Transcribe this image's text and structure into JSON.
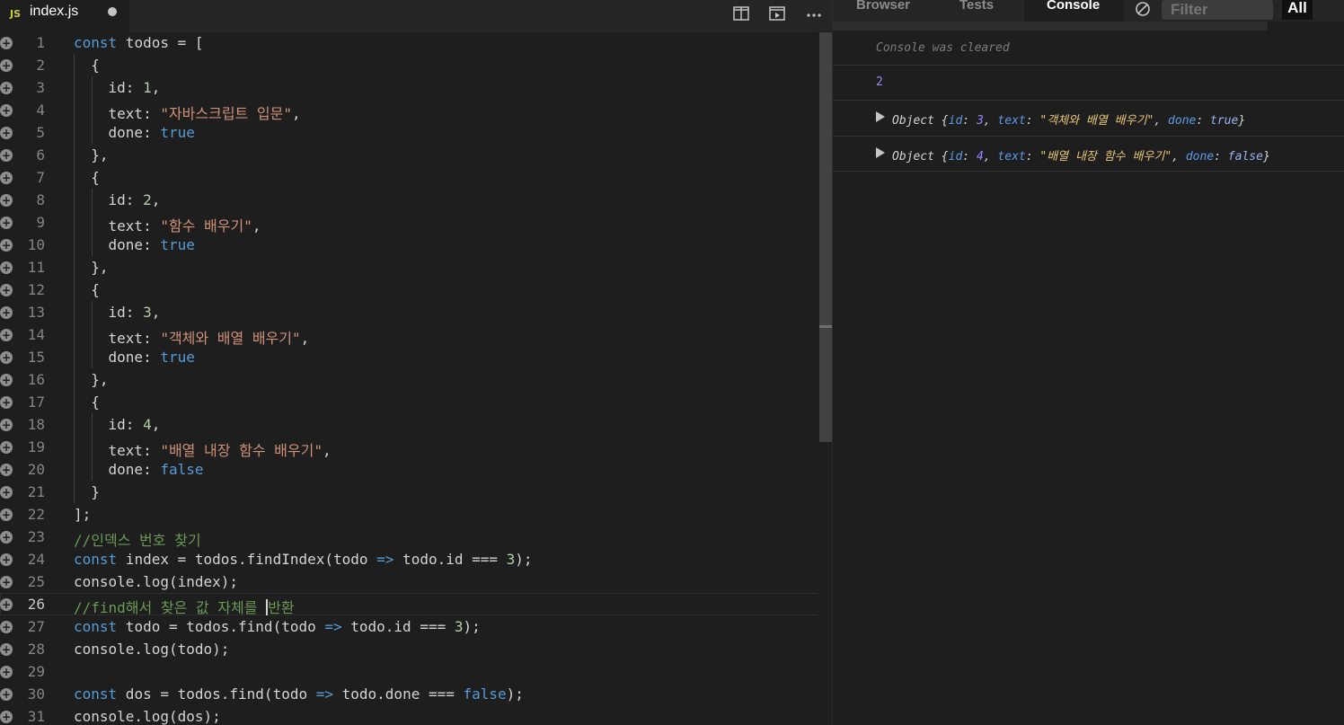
{
  "editor": {
    "tab": {
      "badge": "JS",
      "filename": "index.js"
    },
    "active_line": 26,
    "lines": [
      [
        {
          "t": "const",
          "c": "k"
        },
        {
          "t": " todos = ["
        }
      ],
      [
        {
          "t": "  {"
        }
      ],
      [
        {
          "t": "    id: "
        },
        {
          "t": "1",
          "c": "n"
        },
        {
          "t": ","
        }
      ],
      [
        {
          "t": "    text: "
        },
        {
          "t": "\"자바스크립트 입문\"",
          "c": "s"
        },
        {
          "t": ","
        }
      ],
      [
        {
          "t": "    done: "
        },
        {
          "t": "true",
          "c": "k"
        }
      ],
      [
        {
          "t": "  },"
        }
      ],
      [
        {
          "t": "  {"
        }
      ],
      [
        {
          "t": "    id: "
        },
        {
          "t": "2",
          "c": "n"
        },
        {
          "t": ","
        }
      ],
      [
        {
          "t": "    text: "
        },
        {
          "t": "\"함수 배우기\"",
          "c": "s"
        },
        {
          "t": ","
        }
      ],
      [
        {
          "t": "    done: "
        },
        {
          "t": "true",
          "c": "k"
        }
      ],
      [
        {
          "t": "  },"
        }
      ],
      [
        {
          "t": "  {"
        }
      ],
      [
        {
          "t": "    id: "
        },
        {
          "t": "3",
          "c": "n"
        },
        {
          "t": ","
        }
      ],
      [
        {
          "t": "    text: "
        },
        {
          "t": "\"객체와 배열 배우기\"",
          "c": "s"
        },
        {
          "t": ","
        }
      ],
      [
        {
          "t": "    done: "
        },
        {
          "t": "true",
          "c": "k"
        }
      ],
      [
        {
          "t": "  },"
        }
      ],
      [
        {
          "t": "  {"
        }
      ],
      [
        {
          "t": "    id: "
        },
        {
          "t": "4",
          "c": "n"
        },
        {
          "t": ","
        }
      ],
      [
        {
          "t": "    text: "
        },
        {
          "t": "\"배열 내장 함수 배우기\"",
          "c": "s"
        },
        {
          "t": ","
        }
      ],
      [
        {
          "t": "    done: "
        },
        {
          "t": "false",
          "c": "k"
        }
      ],
      [
        {
          "t": "  }"
        }
      ],
      [
        {
          "t": "];"
        }
      ],
      [
        {
          "t": "//인덱스 번호 찾기",
          "c": "c"
        }
      ],
      [
        {
          "t": "const",
          "c": "k"
        },
        {
          "t": " index = todos.findIndex(todo "
        },
        {
          "t": "=>",
          "c": "k"
        },
        {
          "t": " todo.id === "
        },
        {
          "t": "3",
          "c": "n"
        },
        {
          "t": ");"
        }
      ],
      [
        {
          "t": "console.log(index);"
        }
      ],
      [
        {
          "t": "//find해서 찾은 값 자체를 ",
          "c": "c"
        },
        {
          "t": "|",
          "cursor": true
        },
        {
          "t": "반환",
          "c": "c"
        }
      ],
      [
        {
          "t": "const",
          "c": "k"
        },
        {
          "t": " todo = todos.find(todo "
        },
        {
          "t": "=>",
          "c": "k"
        },
        {
          "t": " todo.id === "
        },
        {
          "t": "3",
          "c": "n"
        },
        {
          "t": ");"
        }
      ],
      [
        {
          "t": "console.log(todo);"
        }
      ],
      [],
      [
        {
          "t": "const",
          "c": "k"
        },
        {
          "t": " dos = todos.find(todo "
        },
        {
          "t": "=>",
          "c": "k"
        },
        {
          "t": " todo.done === "
        },
        {
          "t": "false",
          "c": "k"
        },
        {
          "t": ");"
        }
      ],
      [
        {
          "t": "console.log(dos);"
        }
      ]
    ],
    "gutter_icon": "+"
  },
  "panel": {
    "tabs": [
      {
        "label": "Browser",
        "active": false
      },
      {
        "label": "Tests",
        "active": false
      },
      {
        "label": "Console",
        "active": true
      }
    ],
    "clear_icon": "clear-console-icon",
    "filter_placeholder": "Filter",
    "level_button": "All",
    "console": {
      "cleared_message": "Console was cleared",
      "log_value": "2",
      "objects": [
        {
          "label": "Object",
          "id": "3",
          "text": "\"객체와 배열 배우기\"",
          "done": "true"
        },
        {
          "label": "Object",
          "id": "4",
          "text": "\"배열 내장 함수 배우기\"",
          "done": "false"
        }
      ]
    }
  }
}
